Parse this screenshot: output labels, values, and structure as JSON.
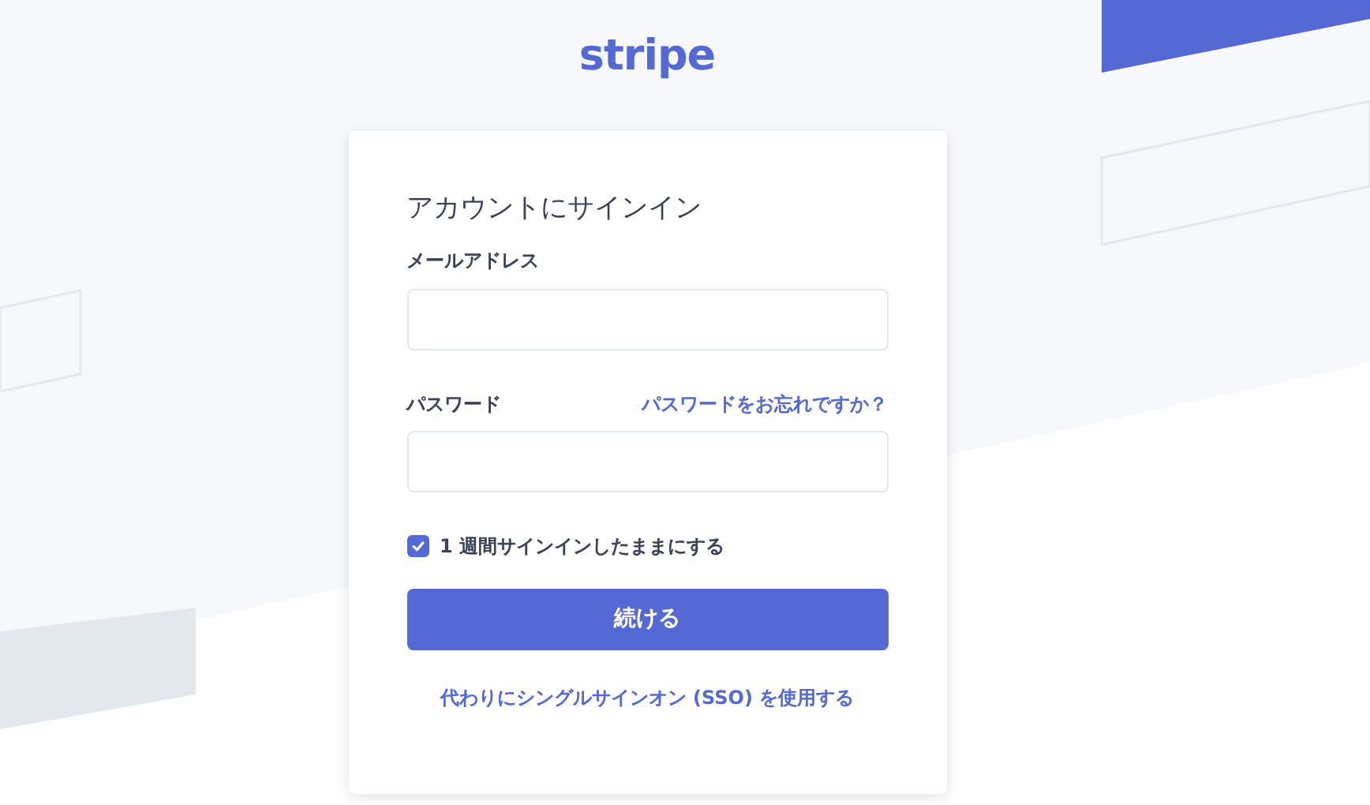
{
  "logo": "stripe",
  "card": {
    "title": "アカウントにサインイン",
    "email": {
      "label": "メールアドレス"
    },
    "password": {
      "label": "パスワード",
      "forgot_link": "パスワードをお忘れですか？"
    },
    "remember": {
      "label": "1 週間サインインしたままにする",
      "checked": true
    },
    "submit": "続ける",
    "sso_link": "代わりにシングルサインオン (SSO) を使用する"
  }
}
